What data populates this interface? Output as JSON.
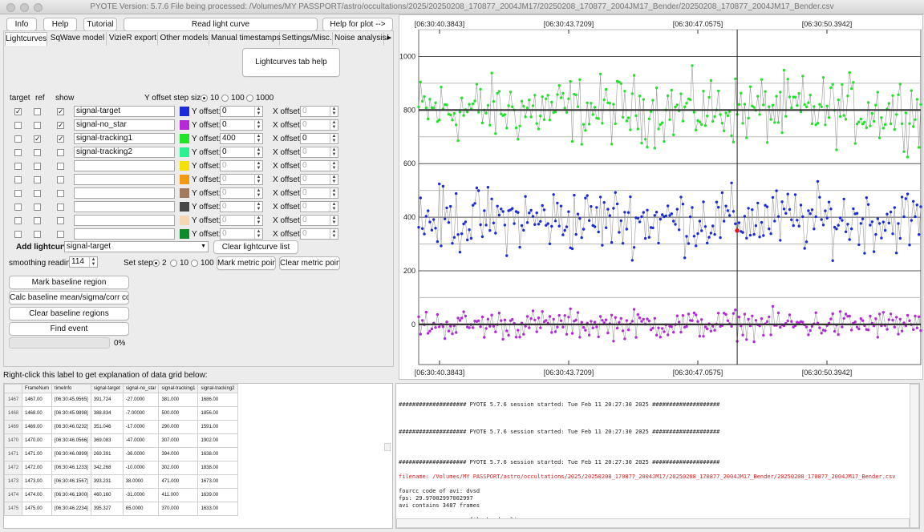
{
  "window": {
    "title": "PYOTE Version: 5.7.6  File being processed: /Volumes/MY PASSPORT/astro/occultations/2025/20250208_170877_2004JM17/20250208_170877_2004JM17_Bender/20250208_170877_2004JM17_Bender.csv"
  },
  "toolbar": {
    "info": "Info",
    "help": "Help",
    "tutorial": "Tutorial",
    "read_lightcurve": "Read light curve",
    "help_for_plot": "Help for plot -->"
  },
  "tabs": [
    "Lightcurves",
    "SqWave model",
    "VizieR export",
    "Other models",
    "Manual timestamps",
    "Settings/Misc.",
    "Noise analysis/"
  ],
  "lightcurves_help": "Lightcurves tab help",
  "table_headers": {
    "target": "target",
    "ref": "ref",
    "show": "show",
    "y_offset_step": "Y offset step size:",
    "y_offset": "Y offset:",
    "x_offset": "X offset:"
  },
  "step_options": [
    "10",
    "100",
    "1000"
  ],
  "lightcurve_rows": [
    {
      "target": true,
      "ref": false,
      "show": true,
      "name": "signal-target",
      "color": "#1a2bd8",
      "y_offset": "0",
      "x_offset": "0",
      "y_enabled": true,
      "x_enabled": false
    },
    {
      "target": false,
      "ref": false,
      "show": true,
      "name": "signal-no_star",
      "color": "#b42ad8",
      "y_offset": "0",
      "x_offset": "0",
      "y_enabled": true,
      "x_enabled": false
    },
    {
      "target": false,
      "ref": true,
      "show": true,
      "name": "signal-tracking1",
      "color": "#22e22a",
      "y_offset": "400",
      "x_offset": "0",
      "y_enabled": true,
      "x_enabled": true
    },
    {
      "target": false,
      "ref": false,
      "show": false,
      "name": "signal-tracking2",
      "color": "#2af28f",
      "y_offset": "0",
      "x_offset": "0",
      "y_enabled": true,
      "x_enabled": false
    },
    {
      "target": false,
      "ref": false,
      "show": false,
      "name": "",
      "color": "#f5e000",
      "y_offset": "0",
      "x_offset": "0",
      "y_enabled": false,
      "x_enabled": false
    },
    {
      "target": false,
      "ref": false,
      "show": false,
      "name": "",
      "color": "#f29a12",
      "y_offset": "0",
      "x_offset": "0",
      "y_enabled": false,
      "x_enabled": false
    },
    {
      "target": false,
      "ref": false,
      "show": false,
      "name": "",
      "color": "#a47a5c",
      "y_offset": "0",
      "x_offset": "0",
      "y_enabled": false,
      "x_enabled": false
    },
    {
      "target": false,
      "ref": false,
      "show": false,
      "name": "",
      "color": "#474747",
      "y_offset": "0",
      "x_offset": "0",
      "y_enabled": false,
      "x_enabled": false
    },
    {
      "target": false,
      "ref": false,
      "show": false,
      "name": "",
      "color": "#f7d7b3",
      "y_offset": "0",
      "x_offset": "0",
      "y_enabled": false,
      "x_enabled": false
    },
    {
      "target": false,
      "ref": false,
      "show": false,
      "name": "",
      "color": "#0f8a2a",
      "y_offset": "0",
      "x_offset": "0",
      "y_enabled": false,
      "x_enabled": false
    }
  ],
  "add_lightcurve": {
    "label": "Add lightcurve",
    "selected": "signal-target",
    "clear_list": "Clear lightcurve list"
  },
  "smoothing": {
    "label": "smoothing readings",
    "value": "114",
    "set_step": "Set step:",
    "options": [
      "2",
      "10",
      "100"
    ],
    "mark_metric": "Mark metric points",
    "clear_metric": "Clear metric points"
  },
  "actions": {
    "mark_baseline": "Mark baseline region",
    "calc_baseline": "Calc baseline mean/sigma/corr coeffs",
    "clear_baseline": "Clear baseline regions",
    "find_event": "Find event",
    "progress": 0,
    "progress_text": "0%"
  },
  "grid_hint": "Right-click this label to get explanation of data grid below:",
  "grid": {
    "columns": [
      "FrameNum",
      "timeInfo",
      "signal-target",
      "signal-no_star",
      "signal-tracking1",
      "signal-tracking2"
    ],
    "rows": [
      [
        "1467",
        "1467.00",
        "[06:30:45.9565]",
        "391.724",
        "-27.0000",
        "381.000",
        "1686.00"
      ],
      [
        "1468",
        "1468.00",
        "[06:30:45.9898]",
        "388.834",
        "-7.00000",
        "500.000",
        "1856.00"
      ],
      [
        "1469",
        "1469.00",
        "[06:30:46.0232]",
        "351.046",
        "-17.0000",
        "290.000",
        "1591.00"
      ],
      [
        "1470",
        "1470.00",
        "[06:30:46.0566]",
        "369.083",
        "-47.0000",
        "307.000",
        "1902.00"
      ],
      [
        "1471",
        "1471.00",
        "[06:30:46.0899]",
        "269.391",
        "-36.0000",
        "394.000",
        "1638.00"
      ],
      [
        "1472",
        "1472.00",
        "[06:30:46.1233]",
        "342.268",
        "-10.0000",
        "302.000",
        "1838.00"
      ],
      [
        "1473",
        "1473.00",
        "[06:30:46.1567]",
        "393.231",
        "38.0000",
        "471.000",
        "1673.00"
      ],
      [
        "1474",
        "1474.00",
        "[06:30:46.1900]",
        "460.160",
        "-31.0000",
        "411.000",
        "1639.00"
      ],
      [
        "1475",
        "1475.00",
        "[06:30:46.2234]",
        "395.327",
        "65.0000",
        "370.000",
        "1633.00"
      ]
    ]
  },
  "log": {
    "lines": [
      {
        "text": "#################### PYOTE 5.7.6 session started: Tue Feb 11 20:27:30 2025 ####################",
        "color": "#222222"
      },
      {
        "text": "#################### PYOTE 5.7.6 session started: Tue Feb 11 20:27:30 2025 ####################",
        "color": "#222222"
      },
      {
        "text": "#################### PYOTE 5.7.6 session started: Tue Feb 11 20:27:30 2025 ####################",
        "color": "#222222"
      },
      {
        "text": "filename: /Volumes/MY PASSPORT/astro/occultations/2025/20250208_170877_2004JM17/20250208_170877_2004JM17_Bender/20250208_170877_2004JM17_Bender.csv",
        "color": "#d42020"
      },
      {
        "text": "fourcc code of avi: dvsd",
        "color": "#222222"
      },
      {
        "text": "fps: 29.97002997002997",
        "color": "#222222"
      },
      {
        "text": "avi contains 3487 frames",
        "color": "#222222"
      },
      {
        "text": "==================== file header lines ====================",
        "color": "#222222"
      }
    ]
  },
  "chart_data": {
    "type": "scatter",
    "x_tick_labels": [
      "[06:30:40.3843]",
      "[06:30:43.7209]",
      "[06:30:47.0575]",
      "[06:30:50.3942]"
    ],
    "yticks": [
      0,
      200,
      400,
      600,
      800,
      1000
    ],
    "ylim": [
      -150,
      1100
    ],
    "x_frame_range": [
      1297,
      1565
    ],
    "cursor_frame": 1467,
    "grid": true,
    "series": [
      {
        "name": "signal-tracking1",
        "color": "#22e22a",
        "mean": 800,
        "spread": 95
      },
      {
        "name": "signal-target",
        "color": "#1a2bd8",
        "mean": 390,
        "spread": 90
      },
      {
        "name": "signal-no_star",
        "color": "#b42ad8",
        "mean": 0,
        "spread": 40
      }
    ],
    "baseline_lines": [
      800,
      0
    ],
    "highlight_point": {
      "frame": 1467,
      "value": 350,
      "color": "#e01a1a"
    }
  }
}
